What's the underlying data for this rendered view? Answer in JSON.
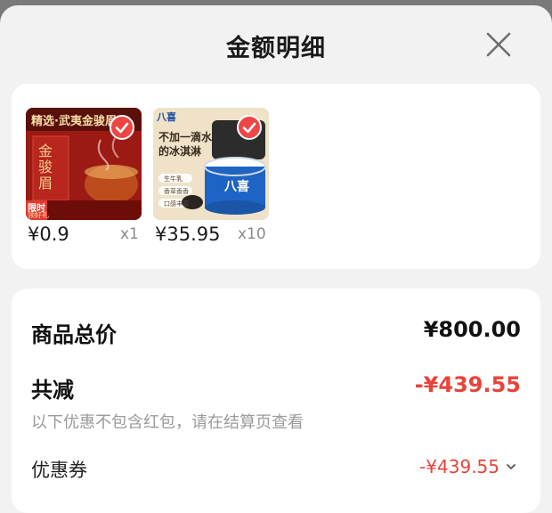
{
  "header": {
    "title": "金额明细"
  },
  "products": [
    {
      "price": "¥0.9",
      "qty": "x1",
      "thumb_text": {
        "headline": "精选·武夷金骏眉",
        "brand": "金骏眉",
        "badge": "限时",
        "badge_sub": "领好礼"
      }
    },
    {
      "price": "¥35.95",
      "qty": "x10",
      "thumb_text": {
        "logo": "八喜",
        "headline_line1": "不加一滴水",
        "headline_line2": "的冰淇淋",
        "tags": [
          "生牛乳",
          "香草香香",
          "口感丰富"
        ],
        "tub_logo": "八喜"
      }
    }
  ],
  "summary": {
    "total_label": "商品总价",
    "total_value": "¥800.00",
    "reduce_label": "共减",
    "reduce_value": "-¥439.55",
    "note": "以下优惠不包含红包，请在结算页查看",
    "coupon_label": "优惠券",
    "coupon_value": "-¥439.55"
  },
  "colors": {
    "accent_red": "#e8433a",
    "check_red": "#f04545"
  }
}
